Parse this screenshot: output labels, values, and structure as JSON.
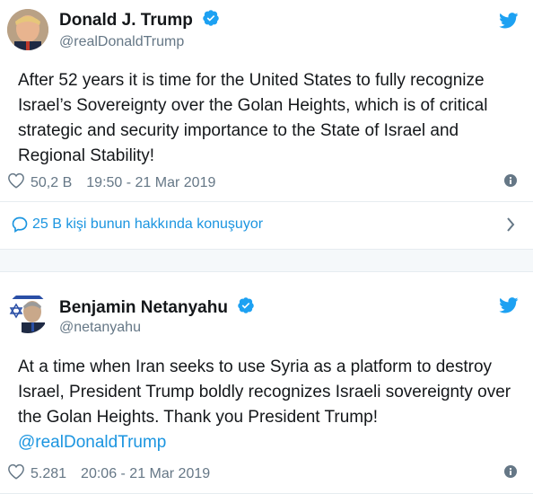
{
  "tweets": [
    {
      "name": "Donald J. Trump",
      "handle": "@realDonaldTrump",
      "text": "After 52 years it is time for the United States to fully recognize Israel’s Sovereignty over the Golan Heights, which is of critical strategic and security importance to the State of Israel and Regional Stability!",
      "likes": "50,2 B",
      "timestamp": "19:50 - 21 Mar 2019"
    },
    {
      "name": "Benjamin Netanyahu",
      "handle": "@netanyahu",
      "text": "At a time when Iran seeks to use Syria as a platform to destroy Israel, President Trump boldly recognizes Israeli sovereignty over the Golan Heights. Thank you President Trump!",
      "mention": "@realDonaldTrump",
      "likes": "5.281",
      "timestamp": "20:06 - 21 Mar 2019"
    }
  ],
  "conversation": {
    "label": "25 B kişi bunun hakkında konuşuyor"
  },
  "colors": {
    "accent": "#1da1f2",
    "link": "#1b95e0",
    "muted": "#657786",
    "text": "#14171a",
    "verified": "#1da1f2"
  },
  "icons": [
    "verified-badge-icon",
    "twitter-bird-icon",
    "heart-icon",
    "info-icon",
    "comment-icon",
    "chevron-right-icon"
  ]
}
